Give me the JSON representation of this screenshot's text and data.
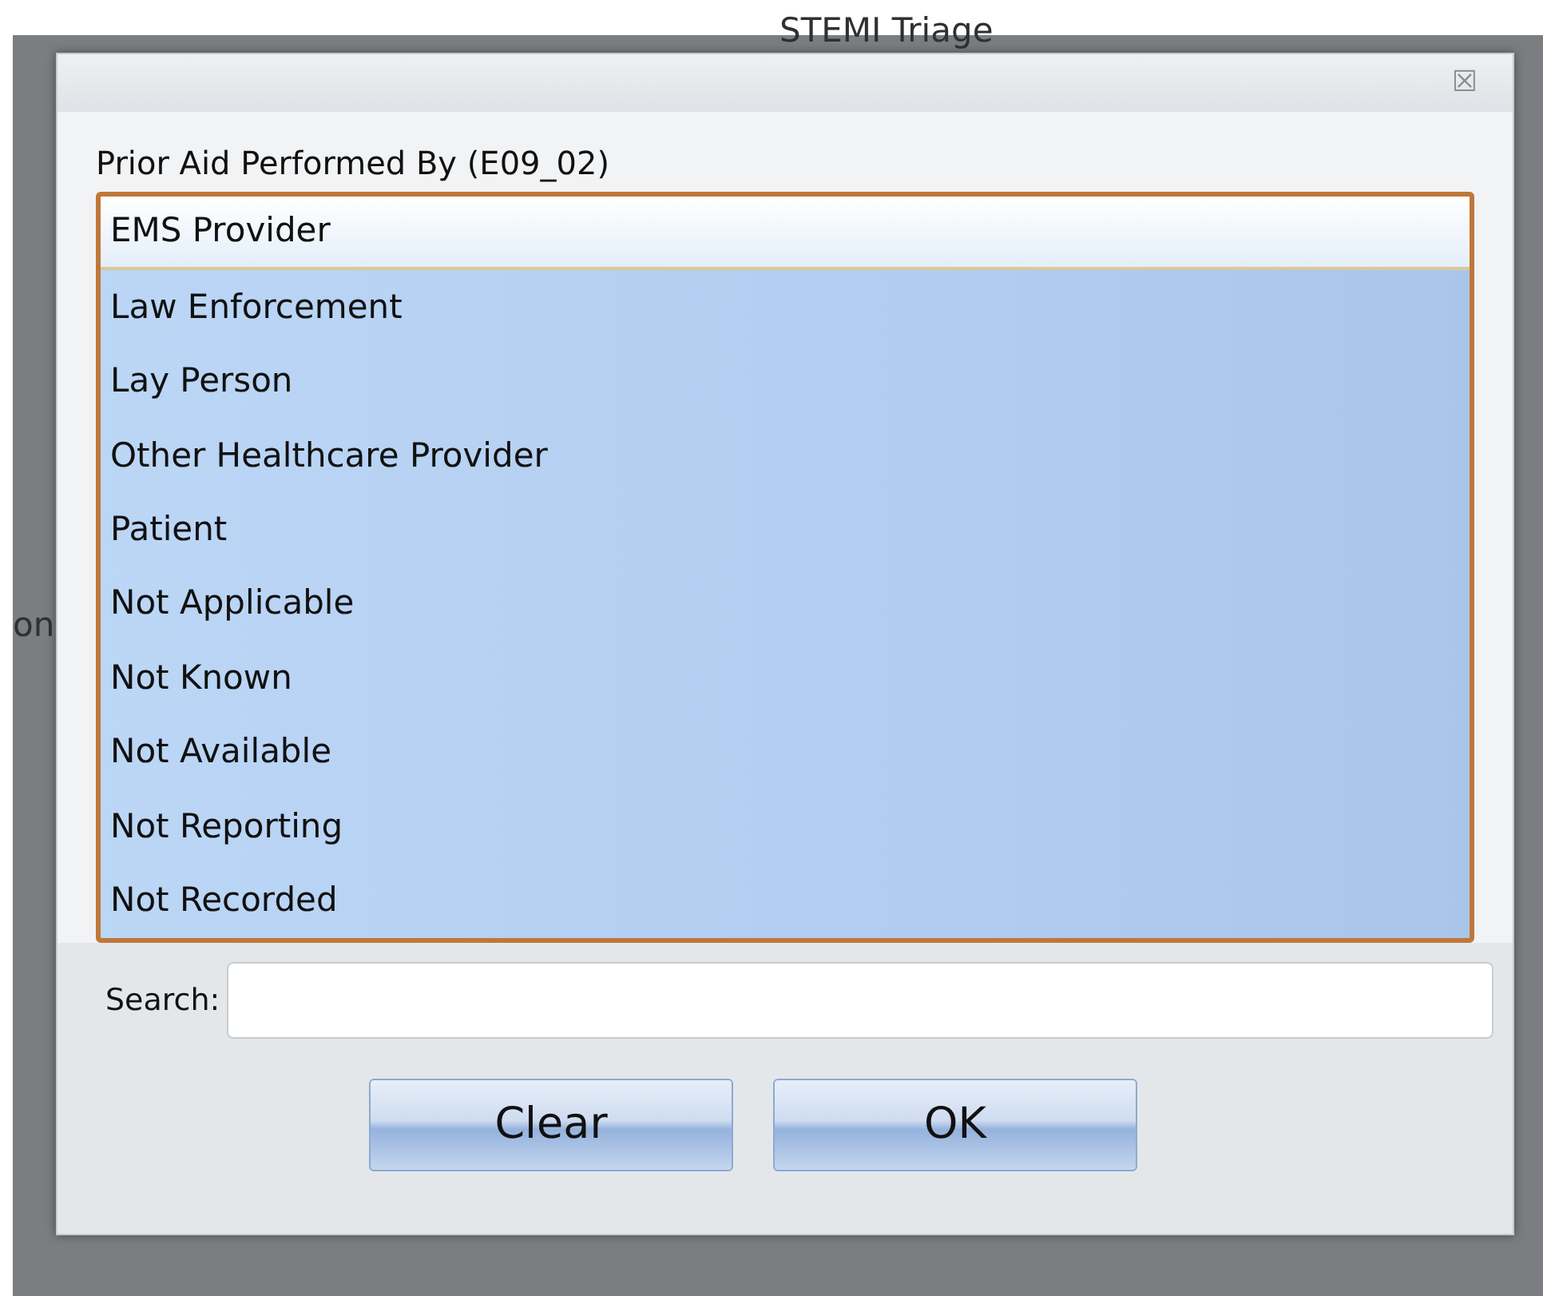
{
  "background": {
    "heading": "STEMI Triage",
    "fragment": "on"
  },
  "dialog": {
    "close": "☒",
    "label": "Prior Aid Performed By (E09_02)",
    "items": [
      {
        "label": "EMS Provider",
        "selected": true
      },
      {
        "label": "Law Enforcement",
        "selected": false
      },
      {
        "label": "Lay Person",
        "selected": false
      },
      {
        "label": "Other Healthcare Provider",
        "selected": false
      },
      {
        "label": "Patient",
        "selected": false
      },
      {
        "label": "Not Applicable",
        "selected": false
      },
      {
        "label": "Not Known",
        "selected": false
      },
      {
        "label": "Not Available",
        "selected": false
      },
      {
        "label": "Not Reporting",
        "selected": false
      },
      {
        "label": "Not Recorded",
        "selected": false
      }
    ],
    "search": {
      "label": "Search:"
    },
    "buttons": [
      "Clear",
      "OK"
    ]
  }
}
